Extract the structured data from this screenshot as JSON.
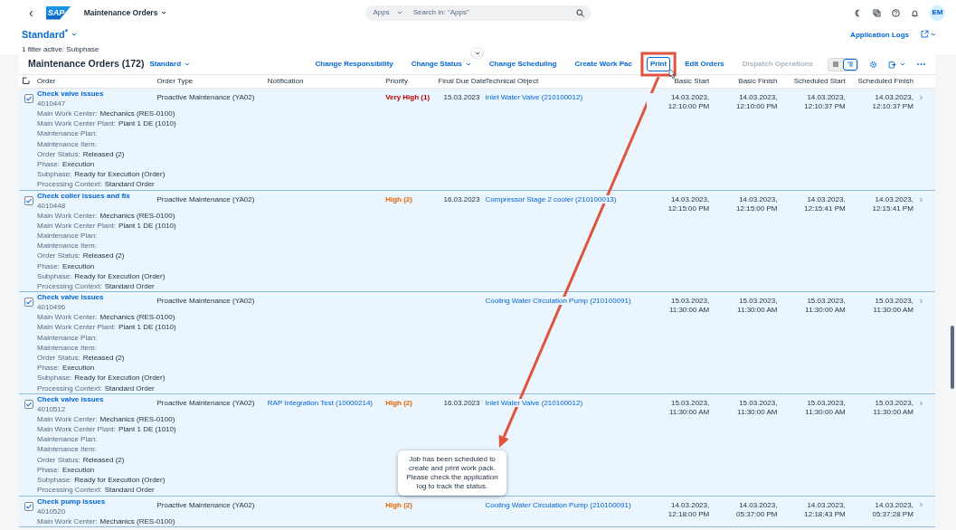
{
  "shell": {
    "back": "‹",
    "logo": "SAP",
    "title": "Maintenance Orders",
    "search": {
      "scope": "Apps",
      "placeholder": "Search in: \"Apps\""
    },
    "avatar": "EM"
  },
  "header": {
    "variant": "Standard$^{*}$",
    "filter_info": "1 filter active: Subphase",
    "app_logs": "Application Logs"
  },
  "table": {
    "title": "Maintenance Orders (172)",
    "variant": "Standard",
    "actions": [
      {
        "label": "Change Responsibility",
        "kind": "button",
        "disabled": false,
        "focused": false
      },
      {
        "label": "Change Status",
        "kind": "menu",
        "disabled": false,
        "focused": false
      },
      {
        "label": "Change Scheduling",
        "kind": "button",
        "disabled": false,
        "focused": false
      },
      {
        "label": "Create Work Pac",
        "kind": "button",
        "disabled": false,
        "focused": false
      },
      {
        "label": "Print",
        "kind": "button",
        "disabled": false,
        "focused": true
      },
      {
        "label": "Edit Orders",
        "kind": "button",
        "disabled": false,
        "focused": false
      },
      {
        "label": "Dispatch Operations",
        "kind": "button",
        "disabled": true,
        "focused": false
      }
    ],
    "view_toggles": [
      {
        "selected": false
      },
      {
        "selected": true
      }
    ],
    "columns": [
      {
        "label": "Order",
        "kind": "text"
      },
      {
        "label": "Order Type",
        "kind": "text"
      },
      {
        "label": "Notification",
        "kind": "text"
      },
      {
        "label": "Priority",
        "kind": "text"
      },
      {
        "label": "Final Due Date",
        "kind": "date"
      },
      {
        "label": "Technical Object",
        "kind": "text"
      },
      {
        "label": "Basic Start",
        "kind": "date"
      },
      {
        "label": "Basic Finish",
        "kind": "date"
      },
      {
        "label": "Scheduled Start",
        "kind": "date"
      },
      {
        "label": "Scheduled Finish",
        "kind": "date"
      }
    ],
    "rows": [
      {
        "selected": true,
        "title": "Check valve issues",
        "number": "4010447",
        "details": [
          {
            "label": "Main Work Center:",
            "value": "Mechanics (RES-0100)"
          },
          {
            "label": "Main Work Center Plant:",
            "value": "Plant 1 DE (1010)"
          },
          {
            "label": "Maintenance Plan:"
          },
          {
            "label": "Maintenance Item:"
          },
          {
            "label": "Order Status:",
            "value": "Released (2)"
          },
          {
            "label": "Phase:",
            "value": "Execution"
          },
          {
            "label": "Subphase:",
            "value": "Ready for Execution (Order)"
          },
          {
            "label": "Processing Context:",
            "value": "Standard Order"
          }
        ],
        "type": "Proactive Maintenance (YA02)",
        "priority": {
          "text": "Very High (1)",
          "color": "#bb0000"
        },
        "due_date": "15.03.2023",
        "technical_object": "Inlet Water Valve (210100012)",
        "basic_start": "14.03.2023, 12:10:00 PM",
        "basic_finish": "14.03.2023, 12:10:00 PM",
        "scheduled_start": "14.03.2023, 12:10:37 PM",
        "scheduled_finish": "14.03.2023, 12:10:37 PM"
      },
      {
        "selected": true,
        "title": "Check coller issues and fix",
        "number": "4010448",
        "details": [
          {
            "label": "Main Work Center:",
            "value": "Mechanics (RES-0100)"
          },
          {
            "label": "Main Work Center Plant:",
            "value": "Plant 1 DE (1010)"
          },
          {
            "label": "Maintenance Plan:"
          },
          {
            "label": "Maintenance Item:"
          },
          {
            "label": "Order Status:",
            "value": "Released (2)"
          },
          {
            "label": "Phase:",
            "value": "Execution"
          },
          {
            "label": "Subphase:",
            "value": "Ready for Execution (Order)"
          },
          {
            "label": "Processing Context:",
            "value": "Standard Order"
          }
        ],
        "type": "Proactive Maintenance (YA02)",
        "priority": {
          "text": "High (2)",
          "color": "#e76500"
        },
        "due_date": "16.03.2023",
        "technical_object": "Compressor Stage 2 cooler (210100013)",
        "basic_start": "14.03.2023, 12:15:00 PM",
        "basic_finish": "14.03.2023, 12:15:00 PM",
        "scheduled_start": "14.03.2023, 12:15:41 PM",
        "scheduled_finish": "14.03.2023, 12:15:41 PM"
      },
      {
        "selected": true,
        "title": "Check valve issues",
        "number": "4010496",
        "details": [
          {
            "label": "Main Work Center:",
            "value": "Mechanics (RES-0100)"
          },
          {
            "label": "Main Work Center Plant:",
            "value": "Plant 1 DE (1010)"
          },
          {
            "label": "Maintenance Plan:"
          },
          {
            "label": "Maintenance Item:"
          },
          {
            "label": "Order Status:",
            "value": "Released (2)"
          },
          {
            "label": "Phase:",
            "value": "Execution"
          },
          {
            "label": "Subphase:",
            "value": "Ready for Execution (Order)"
          },
          {
            "label": "Processing Context:",
            "value": "Standard Order"
          }
        ],
        "type": "Proactive Maintenance (YA02)",
        "technical_object": "Cooling Water Circulation Pump (210100091)",
        "basic_start": "15.03.2023, 11:30:00 AM",
        "basic_finish": "15.03.2023, 11:30:00 AM",
        "scheduled_start": "15.03.2023, 11:30:00 AM",
        "scheduled_finish": "15.03.2023, 11:30:00 AM"
      },
      {
        "selected": true,
        "title": "Check valve issues",
        "number": "4010512",
        "details": [
          {
            "label": "Main Work Center:",
            "value": "Mechanics (RES-0100)"
          },
          {
            "label": "Main Work Center Plant:",
            "value": "Plant 1 DE (1010)"
          },
          {
            "label": "Maintenance Plan:"
          },
          {
            "label": "Maintenance Item:"
          },
          {
            "label": "Order Status:",
            "value": "Released (2)"
          },
          {
            "label": "Phase:",
            "value": "Execution"
          },
          {
            "label": "Subphase:",
            "value": "Ready for Execution (Order)"
          },
          {
            "label": "Processing Context:",
            "value": "Standard Order"
          }
        ],
        "type": "Proactive Maintenance (YA02)",
        "notification": "RAP Integration Test (10000214)",
        "priority": {
          "text": "High (2)",
          "color": "#e76500"
        },
        "due_date": "16.03.2023",
        "technical_object": "Inlet Water Valve (210100012)",
        "basic_start": "15.03.2023, 11:30:00 AM",
        "basic_finish": "15.03.2023, 11:30:00 AM",
        "scheduled_start": "15.03.2023, 11:30:00 AM",
        "scheduled_finish": "15.03.2023, 11:30:00 AM"
      },
      {
        "selected": true,
        "title": "Check pump issues",
        "number": "4010520",
        "details": [
          {
            "label": "Main Work Center:",
            "value": "Mechanics (RES-0100)"
          }
        ],
        "type": "Proactive Maintenance (YA02)",
        "priority": {
          "text": "High (2)",
          "color": "#e76500"
        },
        "technical_object": "Cooling Water Circulation Pump (210100091)",
        "basic_start": "14.03.2023, 12:18:00 PM",
        "basic_finish": "14.03.2023, 05:37:00 PM",
        "scheduled_start": "14.03.2023, 12:18:43 PM",
        "scheduled_finish": "14.03.2023, 05:37:28 PM"
      }
    ]
  },
  "toast": {
    "message": "Job has been scheduled to create and print work pack. Please check the application log to track the status."
  }
}
